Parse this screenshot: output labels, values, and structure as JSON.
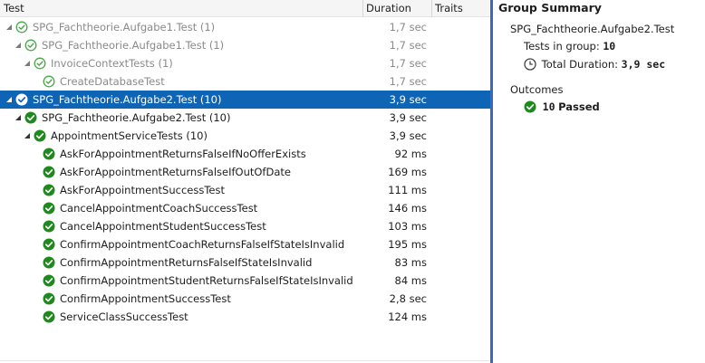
{
  "header": {
    "test": "Test",
    "duration": "Duration",
    "traits": "Traits"
  },
  "rows": [
    {
      "name": "SPG_Fachtheorie.Aufgabe1.Test (1)",
      "duration": "1,7 sec",
      "dim": true
    },
    {
      "name": "SPG_Fachtheorie.Aufgabe1.Test (1)",
      "duration": "1,7 sec",
      "dim": true
    },
    {
      "name": "InvoiceContextTests (1)",
      "duration": "1,7 sec",
      "dim": true
    },
    {
      "name": "CreateDatabaseTest",
      "duration": "1,7 sec",
      "dim": true
    },
    {
      "name": "SPG_Fachtheorie.Aufgabe2.Test (10)",
      "duration": "3,9 sec",
      "selected": true
    },
    {
      "name": "SPG_Fachtheorie.Aufgabe2.Test (10)",
      "duration": "3,9 sec"
    },
    {
      "name": "AppointmentServiceTests (10)",
      "duration": "3,9 sec"
    },
    {
      "name": "AskForAppointmentReturnsFalseIfNoOfferExists",
      "duration": "92 ms"
    },
    {
      "name": "AskForAppointmentReturnsFalseIfOutOfDate",
      "duration": "169 ms"
    },
    {
      "name": "AskForAppointmentSuccessTest",
      "duration": "111 ms"
    },
    {
      "name": "CancelAppointmentCoachSuccessTest",
      "duration": "146 ms"
    },
    {
      "name": "CancelAppointmentStudentSuccessTest",
      "duration": "103 ms"
    },
    {
      "name": "ConfirmAppointmentCoachReturnsFalseIfStateIsInvalid",
      "duration": "195 ms"
    },
    {
      "name": "ConfirmAppointmentReturnsFalseIfStateIsInvalid",
      "duration": "83 ms"
    },
    {
      "name": "ConfirmAppointmentStudentReturnsFalseIfStateIsInvalid",
      "duration": "84 ms"
    },
    {
      "name": "ConfirmAppointmentSuccessTest",
      "duration": "2,8 sec"
    },
    {
      "name": "ServiceClassSuccessTest",
      "duration": "124 ms"
    }
  ],
  "summary": {
    "title": "Group Summary",
    "group_name": "SPG_Fachtheorie.Aufgabe2.Test",
    "tests_label": "Tests in group:",
    "tests_value": "10",
    "duration_label": "Total Duration:",
    "duration_value": "3,9 sec",
    "outcomes_label": "Outcomes",
    "passed_count": "10",
    "passed_label": "Passed"
  },
  "icons": {
    "pass": "passed-check-icon",
    "expander": "expanded-triangle-icon",
    "clock": "clock-icon"
  },
  "colors": {
    "pass_green": "#1e8a1e",
    "pass_dim": "#74b874",
    "selection": "#0e64b5"
  }
}
